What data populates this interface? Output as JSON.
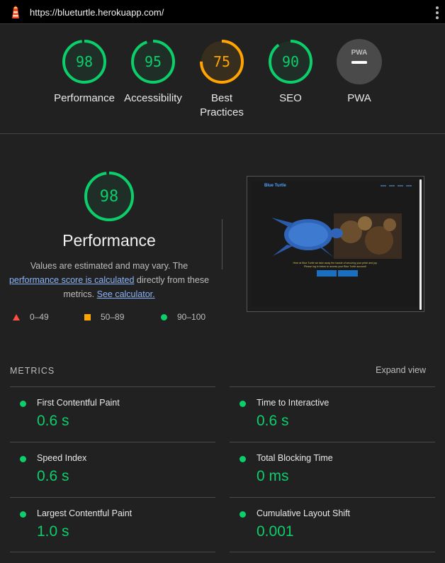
{
  "browser": {
    "url": "https://blueturtle.herokuapp.com/",
    "menu_icon": "kebab-menu-icon",
    "logo_icon": "lighthouse-icon"
  },
  "colors": {
    "pass": "#0cce6b",
    "average": "#ffa400",
    "fail": "#ff4e42",
    "pwa": "#bdbdbd"
  },
  "categories": [
    {
      "label": "Performance",
      "score": "98",
      "status": "pass"
    },
    {
      "label": "Accessibility",
      "score": "95",
      "status": "pass"
    },
    {
      "label": "Best Practices",
      "score": "75",
      "status": "average"
    },
    {
      "label": "SEO",
      "score": "90",
      "status": "pass"
    },
    {
      "label": "PWA",
      "score": "",
      "status": "pwa",
      "badge_text": "PWA"
    }
  ],
  "performance": {
    "score": "98",
    "title": "Performance",
    "desc_part1": "Values are estimated and may vary. The",
    "desc_link1": "performance score is calculated",
    "desc_part2": "directly from these metrics.",
    "desc_link2": "See calculator."
  },
  "legend": [
    {
      "range": "0–49",
      "icon": "fail-triangle-icon"
    },
    {
      "range": "50–89",
      "icon": "average-square-icon"
    },
    {
      "range": "90–100",
      "icon": "pass-circle-icon"
    }
  ],
  "screenshot": {
    "brand": "Blue Turtle",
    "text_line1": "Here at Blue Turtle we take away the hassle of securing your pride and joy.",
    "text_line2": "Please log in below to access your Blue Turtle account!"
  },
  "metrics": {
    "heading": "METRICS",
    "expand_label": "Expand view",
    "items": [
      {
        "title": "First Contentful Paint",
        "value": "0.6 s"
      },
      {
        "title": "Time to Interactive",
        "value": "0.6 s"
      },
      {
        "title": "Speed Index",
        "value": "0.6 s"
      },
      {
        "title": "Total Blocking Time",
        "value": "0 ms"
      },
      {
        "title": "Largest Contentful Paint",
        "value": "1.0 s"
      },
      {
        "title": "Cumulative Layout Shift",
        "value": "0.001"
      }
    ]
  }
}
